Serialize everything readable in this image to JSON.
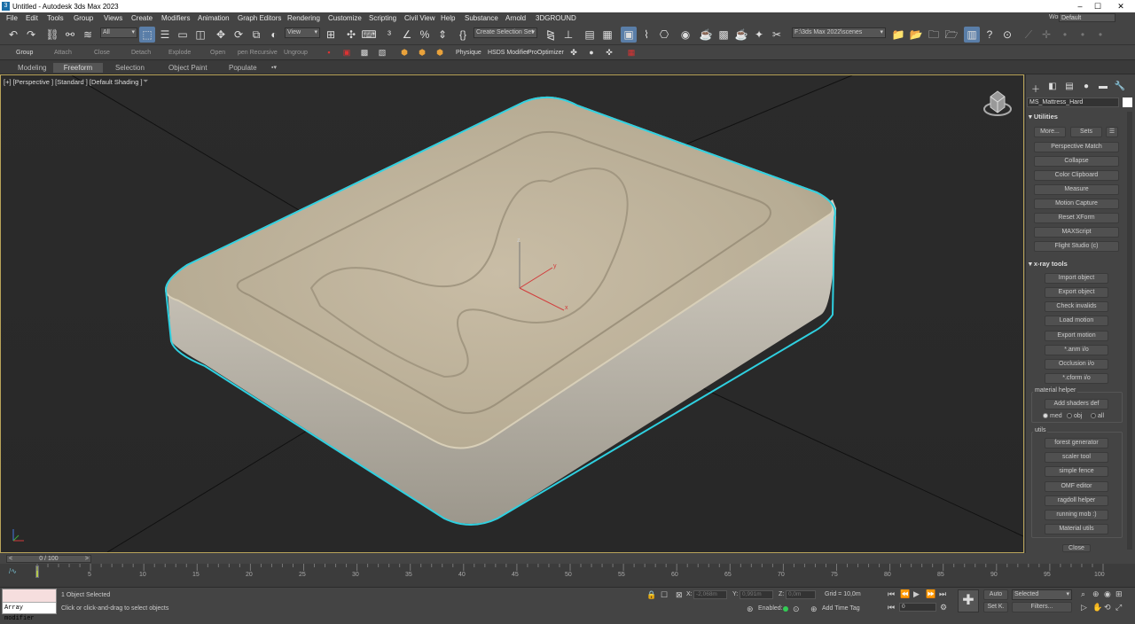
{
  "app": {
    "title": "Untitled - Autodesk 3ds Max 2023",
    "logo": "3"
  },
  "window_controls": {
    "minimize": "–",
    "maximize": "☐",
    "close": "✕"
  },
  "menu": [
    "File",
    "Edit",
    "Tools",
    "Group",
    "Views",
    "Create",
    "Modifiers",
    "Animation",
    "Graph Editors",
    "Rendering",
    "Customize",
    "Scripting",
    "Civil View",
    "Help",
    "Substance",
    "Arnold",
    "3DGROUND"
  ],
  "workspace": {
    "label": "Workspaces:",
    "value": "Default"
  },
  "toolbar": {
    "selection_filter": "All",
    "ref_coord": "View",
    "named_selection": "Create Selection Set",
    "path": "F:\\3ds Max 2022\\scenes"
  },
  "toolbar2": {
    "labels": [
      "Group",
      "Attach",
      "Close",
      "Detach",
      "Explode",
      "Open",
      "pen Recursive",
      "Ungroup"
    ],
    "plugins": [
      "Physique",
      "HSDS Modifier",
      "ProOptimizer"
    ]
  },
  "ribbon": {
    "tabs": [
      "Modeling",
      "Freeform",
      "Selection",
      "Object Paint",
      "Populate"
    ],
    "selected": "Freeform"
  },
  "viewport": {
    "label": "[+] [Perspective ] [Standard ] [Default Shading ]",
    "axes": {
      "x": "x",
      "y": "y",
      "z": "z"
    }
  },
  "command_panel": {
    "object_name": "MS_Mattress_Hard",
    "utilities": {
      "title": "Utilities",
      "more": "More...",
      "sets": "Sets",
      "buttons": [
        "Perspective Match",
        "Collapse",
        "Color Clipboard",
        "Measure",
        "Motion Capture",
        "Reset XForm",
        "MAXScript",
        "Flight Studio (c)"
      ]
    },
    "xray": {
      "title": "x-ray tools",
      "buttons": [
        "Import object",
        "Export object",
        "Check invalids",
        "Load motion",
        "Export motion",
        "*.anm i/o",
        "Occlusion i/o",
        "*.cform i/o"
      ]
    },
    "material_helper": {
      "title": "material helper",
      "button": "Add shaders def",
      "options": [
        "med",
        "obj",
        "all"
      ],
      "selected": "med"
    },
    "utils": {
      "title": "utils",
      "buttons": [
        "forest generator",
        "scaler tool",
        "simple fence",
        "OMF editor",
        "ragdoll helper",
        "running mob :)",
        "Material utils"
      ]
    },
    "close": "Close"
  },
  "timeline": {
    "slider": "0 / 100",
    "ticks": [
      "5",
      "10",
      "15",
      "20",
      "25",
      "30",
      "35",
      "40",
      "45",
      "50",
      "55",
      "60",
      "65",
      "70",
      "75",
      "80",
      "85",
      "90",
      "95",
      "100"
    ],
    "current": 0
  },
  "status": {
    "maxscript": "Array modifier",
    "selected": "1 Object Selected",
    "prompt": "Click or click-and-drag to select objects",
    "x_label": "X:",
    "x_value": "-2,068m",
    "y_label": "Y:",
    "y_value": "0,991m",
    "z_label": "Z:",
    "z_value": "0,0m",
    "grid": "Grid = 10,0m",
    "enabled": "Enabled:",
    "add_time_tag": "Add Time Tag",
    "auto": "Auto",
    "setk": "Set K.",
    "key_filter": "Selected",
    "filters": "Filters...",
    "frame": "0"
  }
}
